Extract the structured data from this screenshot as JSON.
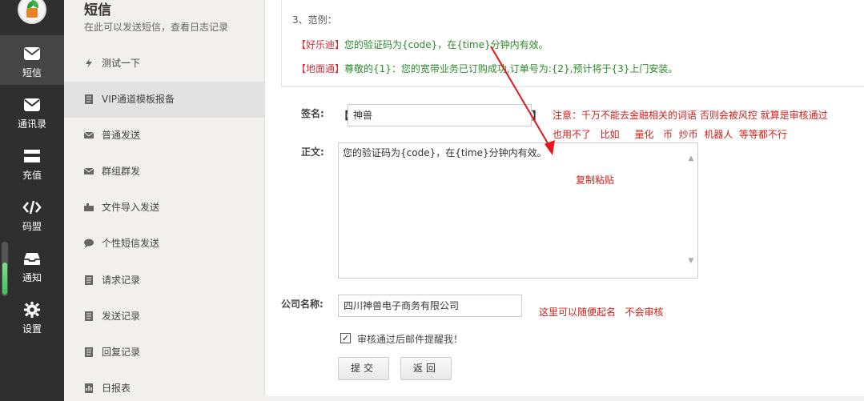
{
  "rail": {
    "items": [
      {
        "label": "短信",
        "icon": "mail-icon"
      },
      {
        "label": "通讯录",
        "icon": "contacts-icon"
      },
      {
        "label": "充值",
        "icon": "card-icon"
      },
      {
        "label": "码盟",
        "icon": "code-icon"
      },
      {
        "label": "通知",
        "icon": "inbox-icon"
      },
      {
        "label": "设置",
        "icon": "gear-icon"
      }
    ]
  },
  "subnav": {
    "title": "短信",
    "subtitle": "在此可以发送短信，查看日志记录",
    "items": [
      {
        "label": "测试一下",
        "icon": "bolt-icon"
      },
      {
        "label": "VIP通道模板报备",
        "icon": "document-icon"
      },
      {
        "label": "普通发送",
        "icon": "envelope-icon"
      },
      {
        "label": "群组群发",
        "icon": "envelope-icon"
      },
      {
        "label": "文件导入发送",
        "icon": "import-icon"
      },
      {
        "label": "个性短信发送",
        "icon": "chat-icon"
      },
      {
        "label": "请求记录",
        "icon": "document-icon"
      },
      {
        "label": "发送记录",
        "icon": "document-icon"
      },
      {
        "label": "回复记录",
        "icon": "document-icon"
      },
      {
        "label": "日报表",
        "icon": "chart-icon"
      }
    ]
  },
  "example": {
    "heading": "3、范例：",
    "line1_tag": "【好乐迪】",
    "line1_text": "您的验证码为{code}，在{time}分钟内有效。",
    "line2_tag": "【地面通】",
    "line2_text": "尊敬的{1}：您的宽带业务已订购成功,订单号为:{2},预计将于{3}上门安装。"
  },
  "form": {
    "signature_label": "签名:",
    "bracket_open": "【",
    "bracket_close": "】",
    "signature_value": "神兽",
    "body_label": "正文:",
    "body_value": "您的验证码为{code}，在{time}分钟内有效。",
    "company_label": "公司名称:",
    "company_value": "四川神兽电子商务有限公司",
    "email_notify_label": "审核通过后邮件提醒我！",
    "email_notify_checked": true,
    "submit_label": "提交",
    "back_label": "返回"
  },
  "annotations": {
    "warning_line1": "注意：千万不能去金融相关的词语 否则会被风控 就算是审核通过",
    "warning_line2": "也用不了   比如     量化   币  炒币  机器人  等等都不行",
    "copy_paste": "复制粘贴",
    "company_note": "这里可以随便起名   不会审核"
  }
}
